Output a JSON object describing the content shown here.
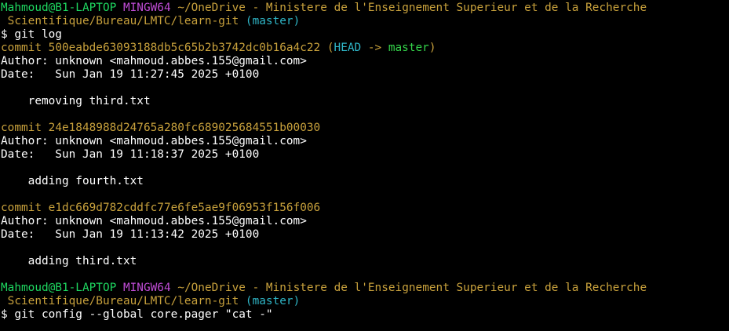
{
  "colors": {
    "background": "#000000",
    "user_host": "#1ed760",
    "msystem": "#c04cd6",
    "path": "#c8a13c",
    "branch": "#2fb6c7",
    "commit_hash": "#c8a13c",
    "head_ref": "#2fb6c7",
    "master_ref": "#34d44a",
    "text": "#ffffff"
  },
  "prompt1": {
    "user_host": "Mahmoud@B1-LAPTOP",
    "msystem": "MINGW64",
    "path_line1": "~/OneDrive - Ministere de l'Enseignement Superieur et de la Recherche",
    "path_line2": " Scientifique/Bureau/LMTC/learn-git",
    "branch": "(master)",
    "command": "$ git log"
  },
  "commits": [
    {
      "commit_label": "commit ",
      "hash": "500eabde63093188db5c65b2b3742dc0b16a4c22",
      "refs_open": " (",
      "head": "HEAD",
      "arrow": " -> ",
      "branch": "master",
      "refs_close": ")",
      "author": "Author: unknown <mahmoud.abbes.155@gmail.com>",
      "date": "Date:   Sun Jan 19 11:27:45 2025 +0100",
      "message": "    removing third.txt"
    },
    {
      "commit_label": "commit ",
      "hash": "24e1848988d24765a280fc689025684551b00030",
      "author": "Author: unknown <mahmoud.abbes.155@gmail.com>",
      "date": "Date:   Sun Jan 19 11:18:37 2025 +0100",
      "message": "    adding fourth.txt"
    },
    {
      "commit_label": "commit ",
      "hash": "e1dc669d782cddfc77e6fe5ae9f06953f156f006",
      "author": "Author: unknown <mahmoud.abbes.155@gmail.com>",
      "date": "Date:   Sun Jan 19 11:13:42 2025 +0100",
      "message": "    adding third.txt"
    }
  ],
  "prompt2": {
    "user_host": "Mahmoud@B1-LAPTOP",
    "msystem": "MINGW64",
    "path_line1": "~/OneDrive - Ministere de l'Enseignement Superieur et de la Recherche",
    "path_line2": " Scientifique/Bureau/LMTC/learn-git",
    "branch": "(master)",
    "command": "$ git config --global core.pager \"cat -\""
  }
}
